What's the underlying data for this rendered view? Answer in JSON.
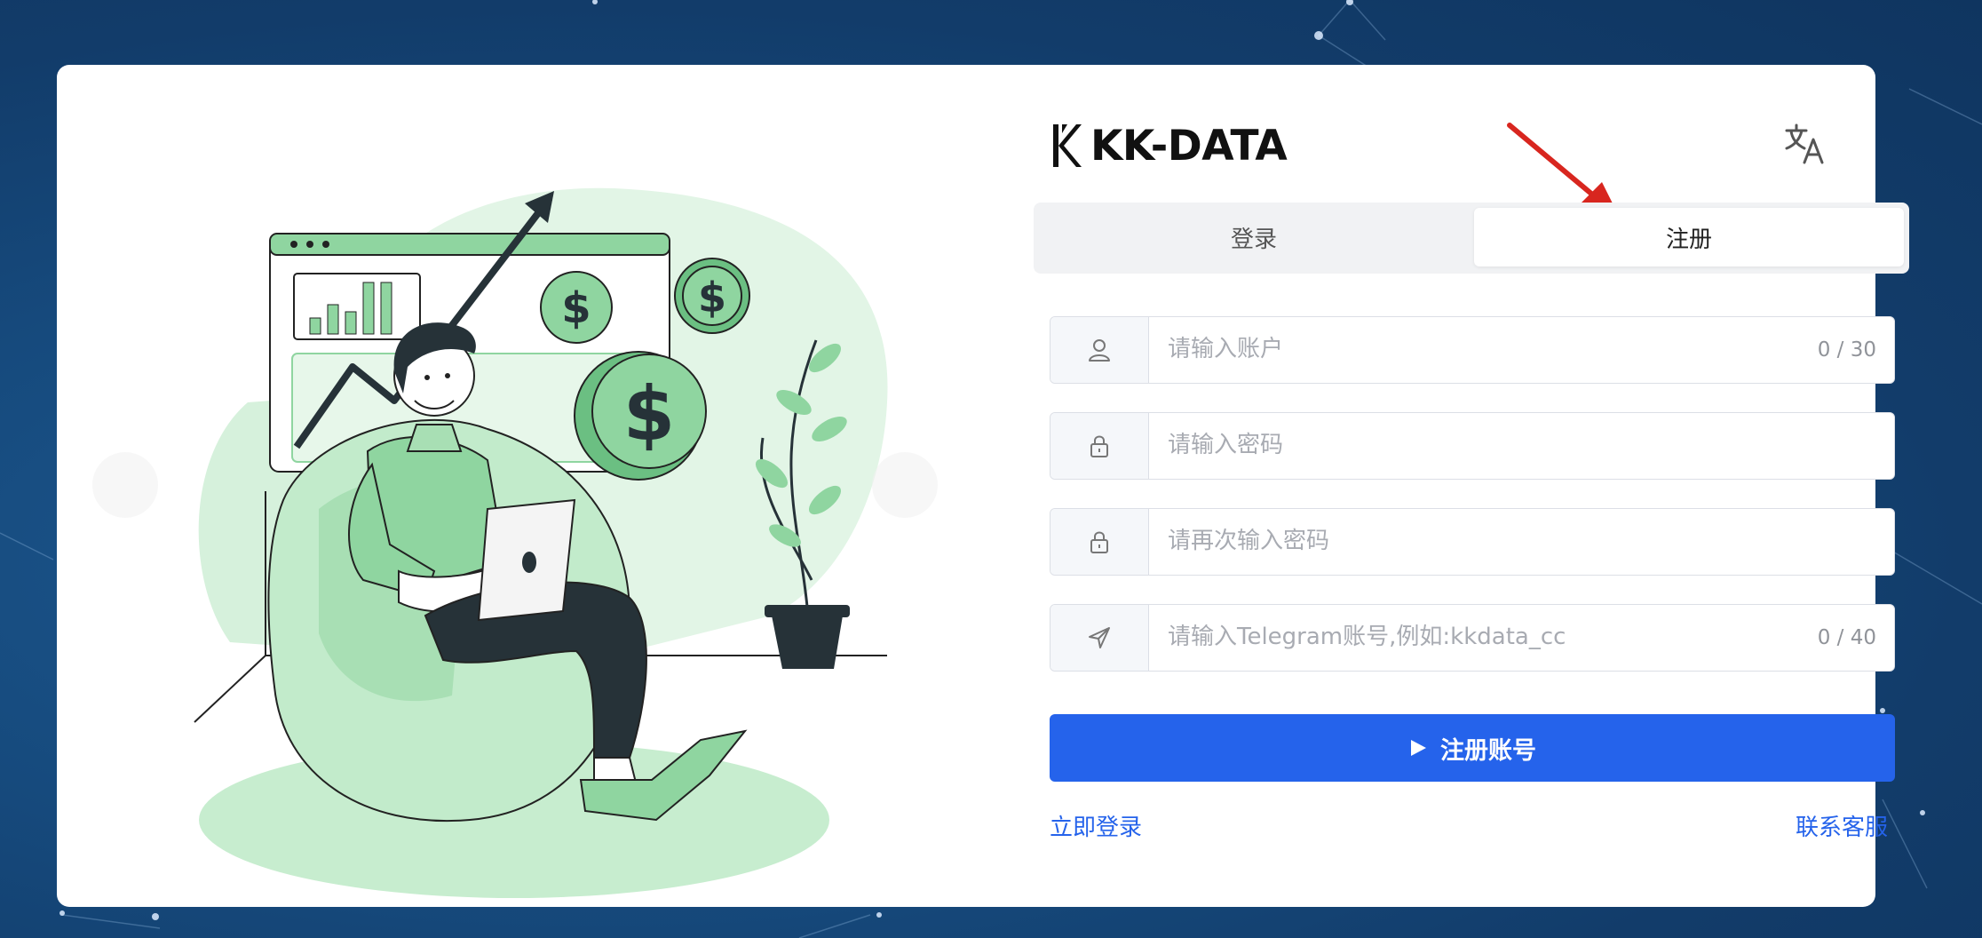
{
  "brand": {
    "name": "KK-DATA"
  },
  "tabs": [
    {
      "label": "登录",
      "active": false
    },
    {
      "label": "注册",
      "active": true
    }
  ],
  "fields": {
    "account": {
      "placeholder": "请输入账户",
      "value": "",
      "counter": "0 / 30",
      "icon": "user-icon"
    },
    "password": {
      "placeholder": "请输入密码",
      "value": "",
      "icon": "lock-icon"
    },
    "confirm_password": {
      "placeholder": "请再次输入密码",
      "value": "",
      "icon": "lock-icon"
    },
    "telegram": {
      "placeholder": "请输入Telegram账号,例如:kkdata_cc",
      "value": "",
      "counter": "0 / 40",
      "icon": "send-icon"
    }
  },
  "submit": {
    "label": "注册账号",
    "icon": "play-icon"
  },
  "links": {
    "login": "立即登录",
    "support": "联系客服"
  },
  "colors": {
    "primary": "#2563eb",
    "accent_green": "#8fd5a0",
    "annotation_red": "#d8261f",
    "background": "#164a7d"
  }
}
